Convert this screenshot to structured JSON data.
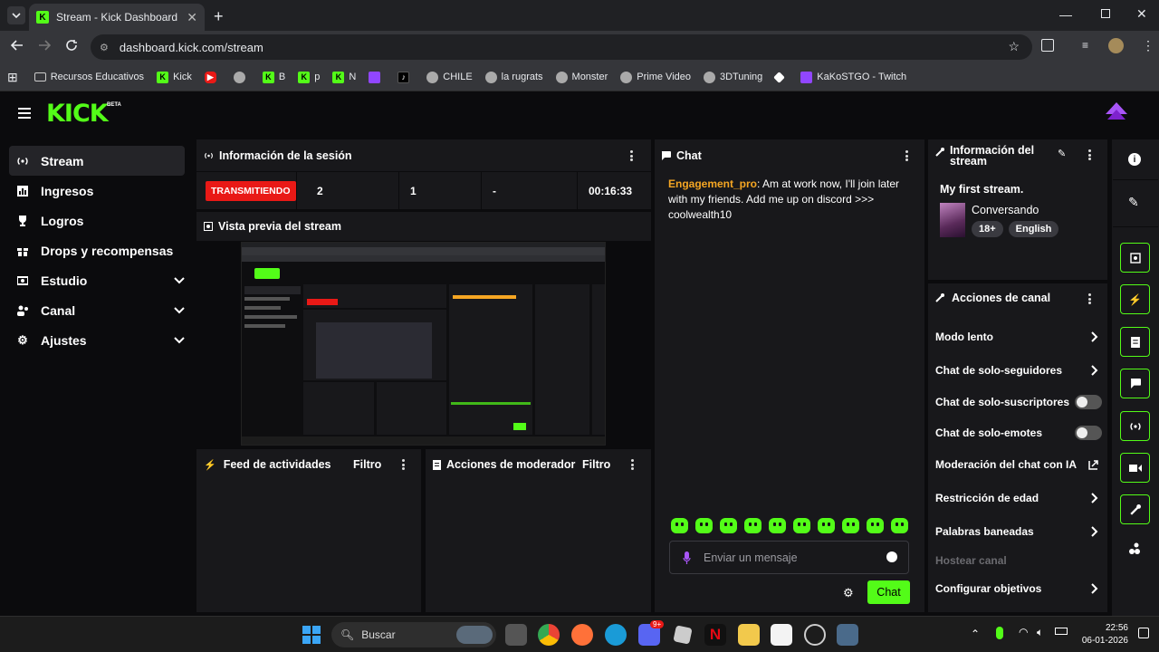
{
  "browser": {
    "tab_title": "Stream - Kick Dashboard",
    "url": "dashboard.kick.com/stream",
    "bookmarks": [
      "Recursos Educativos",
      "Kick",
      "B",
      "p",
      "N",
      "CHILE",
      "la rugrats",
      "Monster",
      "Prime Video",
      "3DTuning",
      "KaKoSTGO - Twitch"
    ]
  },
  "header": {
    "logo": "KICK",
    "beta": "BETA"
  },
  "sidebar": {
    "items": [
      {
        "label": "Stream",
        "icon": "broadcast-icon"
      },
      {
        "label": "Ingresos",
        "icon": "chart-icon"
      },
      {
        "label": "Logros",
        "icon": "trophy-icon"
      },
      {
        "label": "Drops y recompensas",
        "icon": "gift-icon"
      },
      {
        "label": "Estudio",
        "icon": "camera-icon"
      },
      {
        "label": "Canal",
        "icon": "users-icon"
      },
      {
        "label": "Ajustes",
        "icon": "gear-icon"
      }
    ]
  },
  "session": {
    "title": "Información de la sesión",
    "status": "TRANSMITIENDO",
    "stat1": "2",
    "stat2": "1",
    "stat3": "-",
    "duration": "00:16:33"
  },
  "preview": {
    "title": "Vista previa del stream"
  },
  "feed": {
    "title": "Feed de actividades",
    "filter": "Filtro"
  },
  "moderator": {
    "title": "Acciones de moderador",
    "filter": "Filtro"
  },
  "chat": {
    "title": "Chat",
    "username": "Engagement_pro",
    "message": ": Am at work now, I'll join later with my friends. Add me up on discord >>> coolwealth10",
    "placeholder": "Enviar un mensaje",
    "send": "Chat"
  },
  "stream_info": {
    "title": "Información del stream",
    "stream_title": "My first stream.",
    "category": "Conversando",
    "tags": [
      "18+",
      "English"
    ]
  },
  "channel_actions": {
    "title": "Acciones de canal",
    "items": [
      {
        "label": "Modo lento",
        "control": "chevron"
      },
      {
        "label": "Chat de solo-seguidores",
        "control": "chevron"
      },
      {
        "label": "Chat de solo-suscriptores",
        "control": "toggle"
      },
      {
        "label": "Chat de solo-emotes",
        "control": "toggle"
      },
      {
        "label": "Moderación del chat con IA",
        "control": "external"
      },
      {
        "label": "Restricción de edad",
        "control": "chevron"
      },
      {
        "label": "Palabras baneadas",
        "control": "chevron"
      },
      {
        "label": "Hostear canal",
        "control": "disabled"
      },
      {
        "label": "Configurar objetivos",
        "control": "chevron"
      }
    ]
  },
  "taskbar": {
    "search": "Buscar",
    "time": "22:56",
    "date": "06-01-2026",
    "badge": "9+"
  },
  "colors": {
    "accent": "#53fc18",
    "live": "#e91916",
    "username": "#f5a623",
    "bg": "#0b0b0d",
    "panel": "#18181b"
  }
}
